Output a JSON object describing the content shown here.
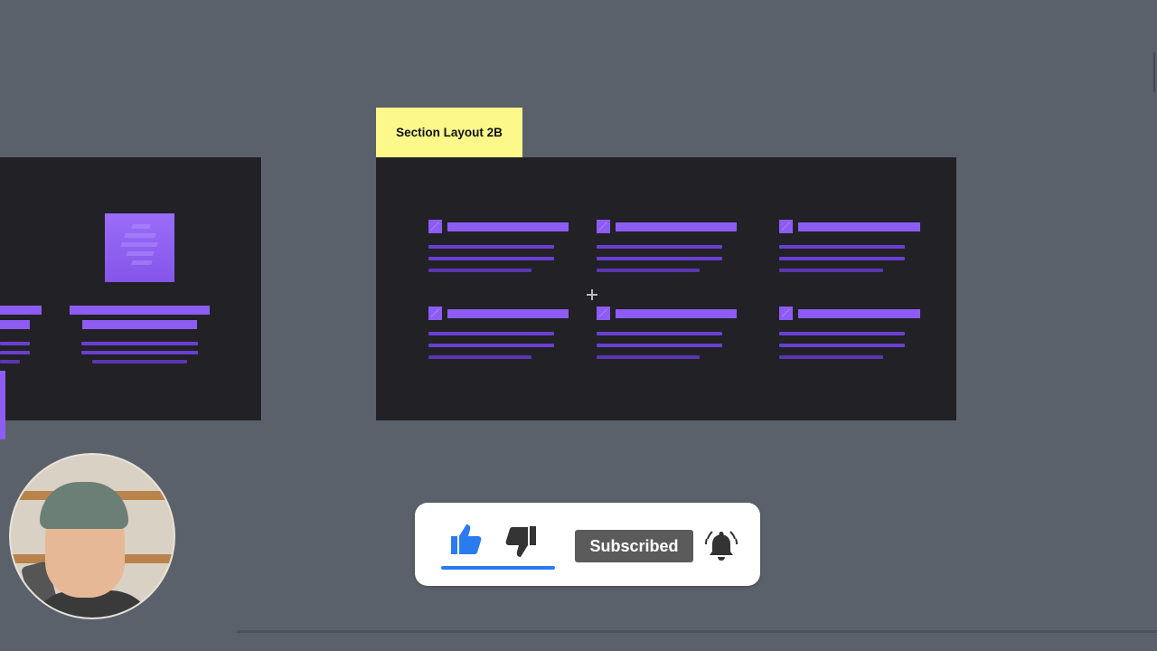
{
  "canvas": {
    "section_label": "Section Layout 2B"
  },
  "overlay": {
    "subscribe_label": "Subscribed",
    "like_icon": "thumbs-up-icon",
    "dislike_icon": "thumbs-down-icon",
    "bell_icon": "notification-bell-icon"
  },
  "colors": {
    "background": "#5b616b",
    "frame": "#212126",
    "accent_purple": "#8d5cf2",
    "sticky_yellow": "#fcf88a",
    "like_blue": "#2b7bf0"
  }
}
